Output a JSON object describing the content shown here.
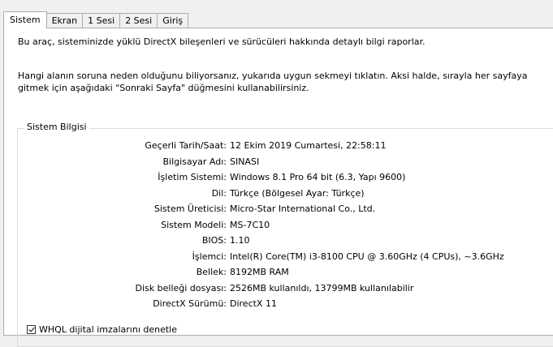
{
  "tabs": [
    "Sistem",
    "Ekran",
    "1 Sesi",
    "2 Sesi",
    "Giriş"
  ],
  "intro": {
    "line1": "Bu araç, sisteminizde yüklü DirectX bileşenleri ve sürücüleri hakkında detaylı bilgi raporlar.",
    "line2": "Hangi alanın soruna neden olduğunu biliyorsanız, yukarıda uygun sekmeyi tıklatın.  Aksi halde, sırayla her sayfaya gitmek için aşağıdaki \"Sonraki Sayfa\" düğmesini kullanabilirsiniz."
  },
  "system_info": {
    "title": "Sistem Bilgisi",
    "rows": [
      {
        "label": "Geçerli Tarih/Saat:",
        "value": "12 Ekim 2019 Cumartesi, 22:58:11"
      },
      {
        "label": "Bilgisayar Adı:",
        "value": "SINASI"
      },
      {
        "label": "İşletim Sistemi:",
        "value": "Windows 8.1 Pro 64 bit (6.3, Yapı 9600)"
      },
      {
        "label": "Dil:",
        "value": "Türkçe (Bölgesel Ayar: Türkçe)"
      },
      {
        "label": "Sistem Üreticisi:",
        "value": "Micro-Star International Co., Ltd."
      },
      {
        "label": "Sistem Modeli:",
        "value": "MS-7C10"
      },
      {
        "label": "BIOS:",
        "value": "1.10"
      },
      {
        "label": "İşlemci:",
        "value": "Intel(R) Core(TM) i3-8100 CPU @ 3.60GHz (4 CPUs), ~3.6GHz"
      },
      {
        "label": "Bellek:",
        "value": "8192MB RAM"
      },
      {
        "label": "Disk belleği dosyası:",
        "value": "2526MB kullanıldı, 13799MB kullanılabilir"
      },
      {
        "label": "DirectX Sürümü:",
        "value": "DirectX 11"
      }
    ]
  },
  "checkbox": {
    "label": "WHQL dijital imzalarını denetle"
  }
}
